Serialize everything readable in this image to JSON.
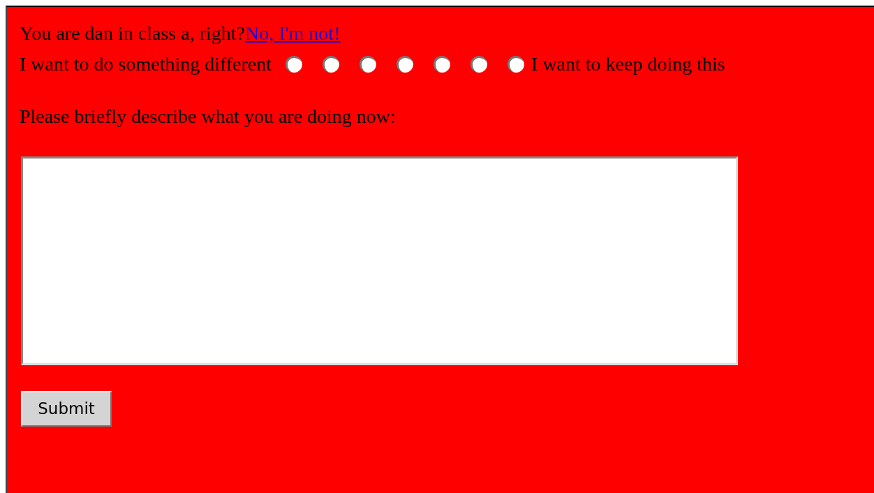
{
  "question": {
    "text": "You are dan in class a, right?",
    "link": "No, I'm not!"
  },
  "scale": {
    "low_label": "I want to do something different",
    "high_label": "I want to keep doing this",
    "options": [
      {
        "selected": false
      },
      {
        "selected": false
      },
      {
        "selected": false
      },
      {
        "selected": false
      },
      {
        "selected": false
      },
      {
        "selected": false
      },
      {
        "selected": false
      }
    ]
  },
  "prompt": "Please briefly describe what you are doing now:",
  "submit": "Submit"
}
